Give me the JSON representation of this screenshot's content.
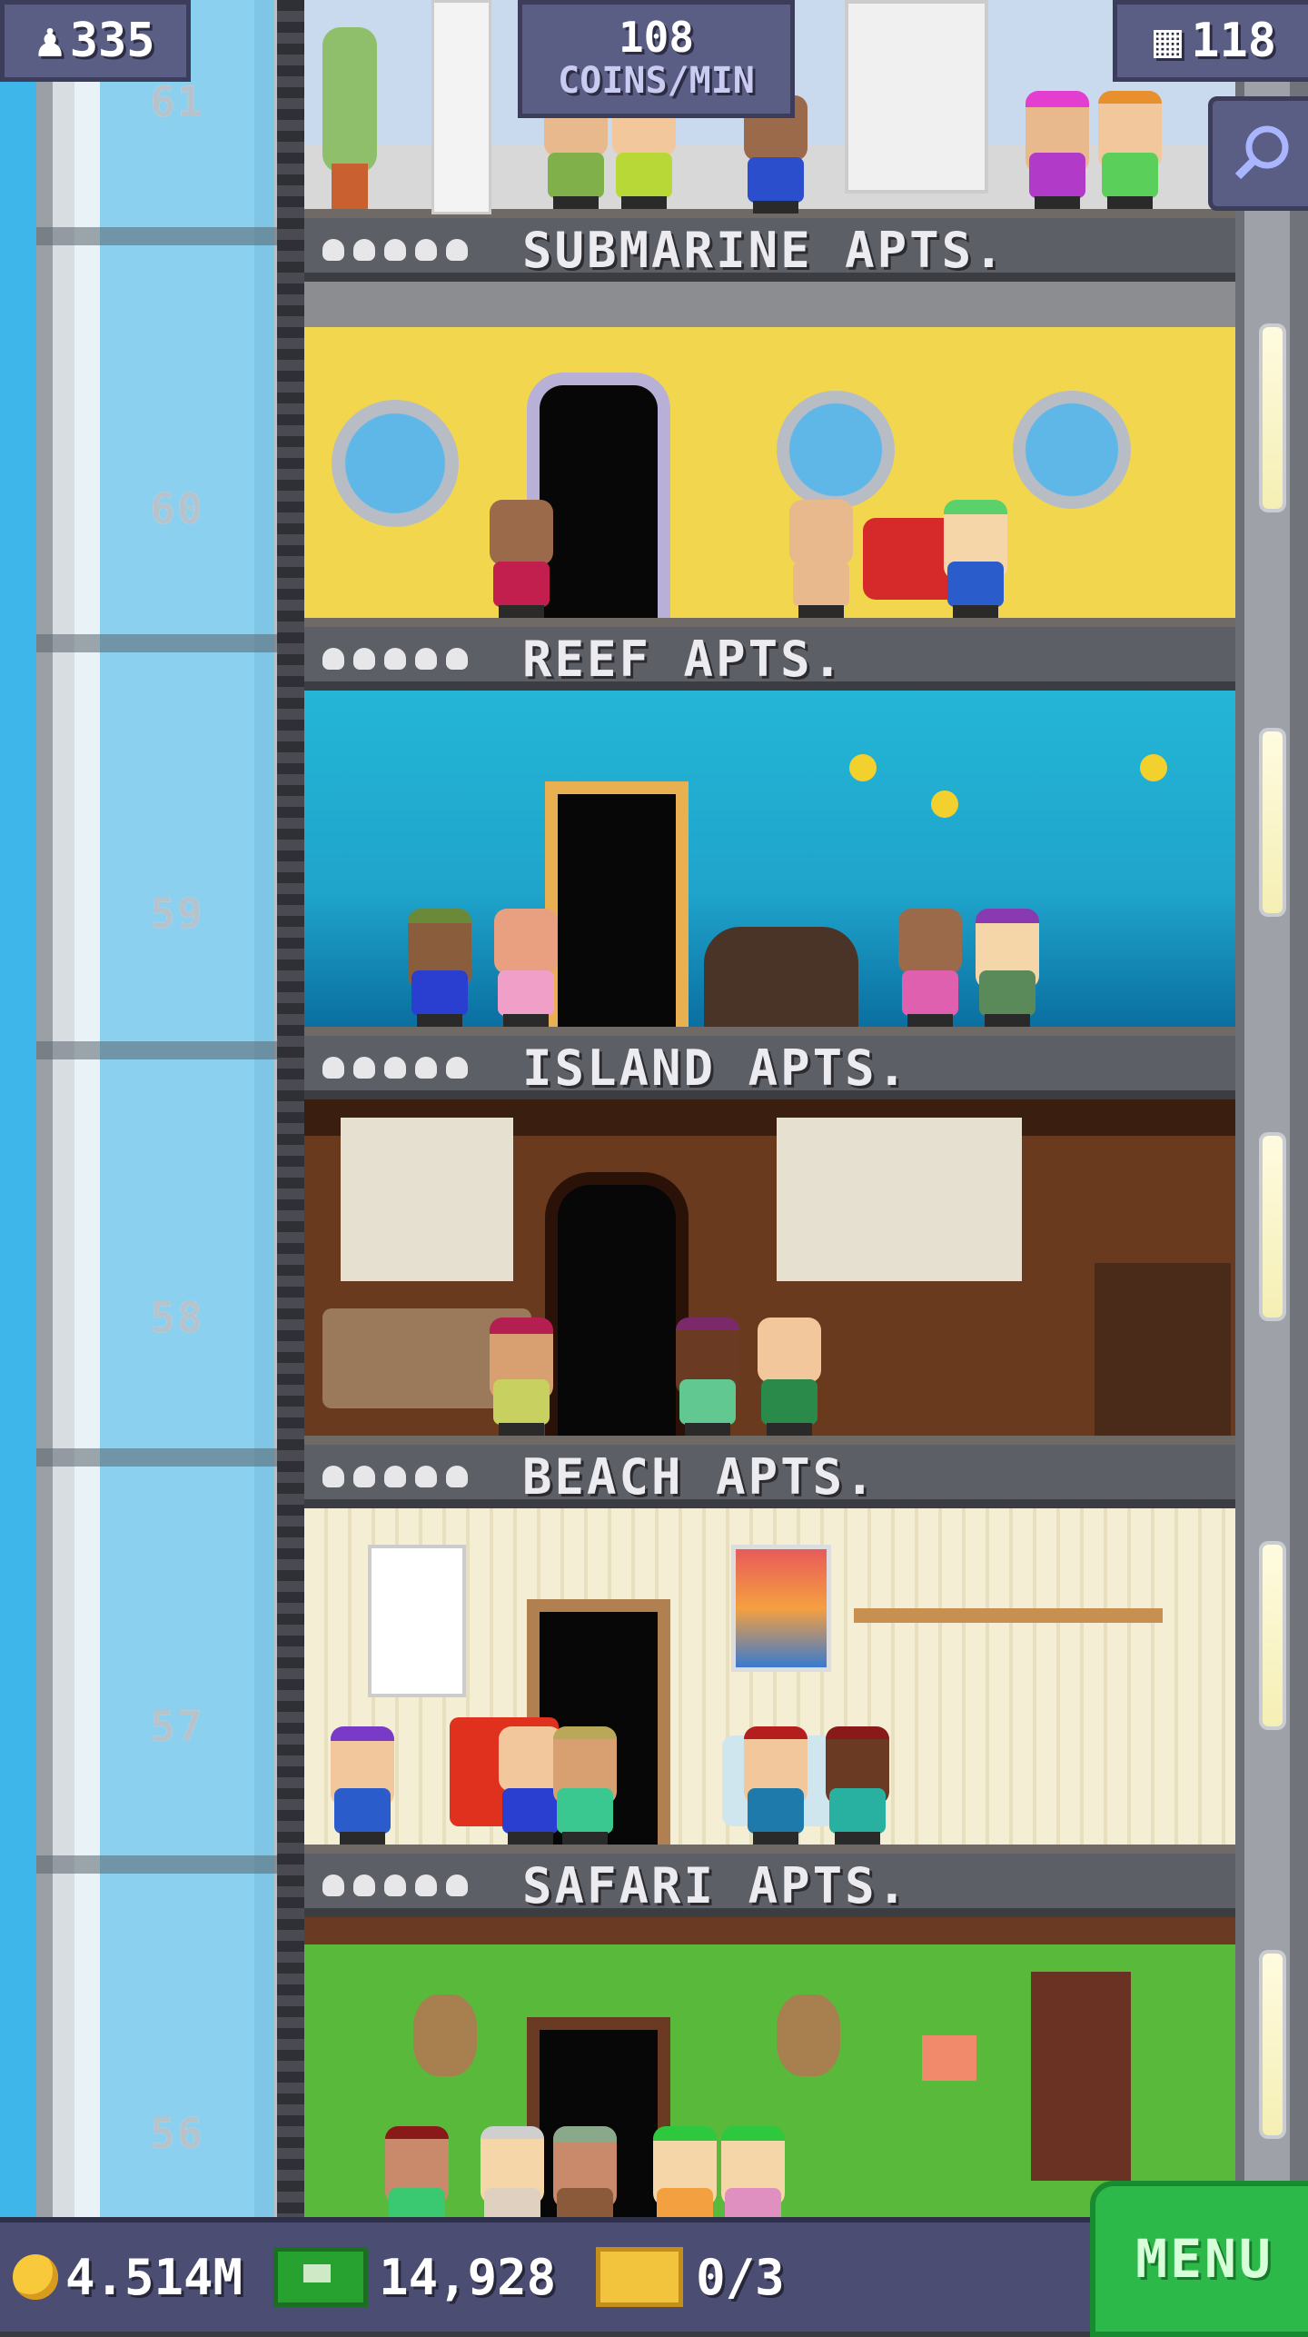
{
  "hud": {
    "residents": "335",
    "coins_per_min_value": "108",
    "coins_per_min_label": "COINS/MIN",
    "floors": "118"
  },
  "shaft_floor_numbers": [
    "61",
    "60",
    "59",
    "58",
    "57",
    "56"
  ],
  "floors": [
    {
      "name": "SUBMARINE APTS.",
      "theme": "submarine"
    },
    {
      "name": "REEF APTS.",
      "theme": "reef"
    },
    {
      "name": "ISLAND APTS.",
      "theme": "island"
    },
    {
      "name": "BEACH APTS.",
      "theme": "beach"
    },
    {
      "name": "SAFARI APTS.",
      "theme": "safari"
    }
  ],
  "bottom_bar": {
    "coins": "4.514M",
    "bux": "14,928",
    "tickets": "0/3",
    "menu_label": "MENU"
  },
  "colors": {
    "hud_bg": "#5a5e84",
    "menu_green": "#2db94a",
    "sky": "#3fb6ea"
  }
}
